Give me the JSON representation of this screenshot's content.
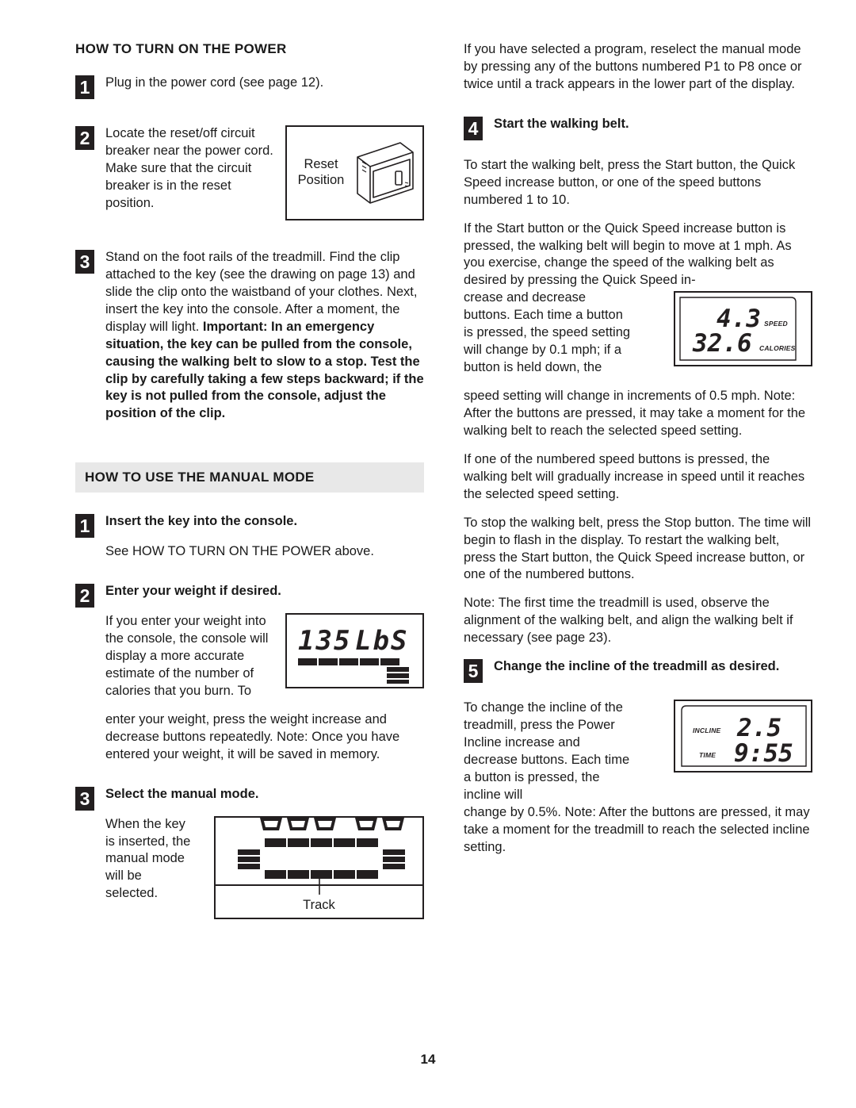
{
  "page": {
    "number": "14"
  },
  "left_column": {
    "section1": {
      "title": "HOW TO TURN ON THE POWER",
      "steps": [
        {
          "num": "1",
          "text": "Plug in the power cord (see page 12)."
        },
        {
          "num": "2",
          "text": "Locate the reset/off circuit breaker near the power cord. Make sure that the circuit breaker is in the reset position.",
          "figure": {
            "name": "reset-position-diagram",
            "label_line1": "Reset",
            "label_line2": "Position"
          }
        },
        {
          "num": "3",
          "text_normal": "Stand on the foot rails of the treadmill. Find the clip attached to the key (see the drawing on page 13) and slide the clip onto the waistband of your clothes. Next, insert the key into the console. After a moment, the display will light. ",
          "text_bold": "Important: In an emergency situation, the key can be pulled from the console, causing the walking belt to slow to a stop. Test the clip by carefully taking a few steps backward; if the key is not pulled from the console, adjust the position of the clip."
        }
      ]
    },
    "section2": {
      "title": "HOW TO USE THE MANUAL MODE",
      "steps": [
        {
          "num": "1",
          "heading": "Insert the key into the console.",
          "body": "See HOW TO TURN ON THE POWER above."
        },
        {
          "num": "2",
          "heading": "Enter your weight if desired.",
          "body_wrap": "If you enter your weight into the console, the console will display a more accurate estimate of the number of calories that you burn. To",
          "body_rest": "enter your weight, press the weight increase and decrease buttons repeatedly. Note: Once you have entered your weight, it will be saved in memory.",
          "figure": {
            "name": "weight-display",
            "value": "135",
            "unit": "LbS"
          }
        },
        {
          "num": "3",
          "heading": "Select the manual mode.",
          "body": "When the key is inserted, the manual mode will be selected.",
          "figure": {
            "name": "track-display",
            "caption": "Track"
          }
        }
      ]
    }
  },
  "right_column": {
    "intro_paragraph": "If you have selected a program, reselect the manual mode by pressing any of the buttons numbered P1 to P8 once or twice until a track appears in the lower part of the display.",
    "steps": [
      {
        "num": "4",
        "heading": "Start the walking belt.",
        "paragraphs": [
          "To start the walking belt, press the Start button, the Quick Speed increase button, or one of the speed buttons numbered 1 to 10.",
          "If the Start button or the Quick Speed increase button is pressed, the walking belt will begin to move at 1 mph. As you exercise, change the speed of the walking belt as desired by pressing the Quick Speed in-",
          "crease and decrease buttons. Each time a button is pressed, the speed setting will change by 0.1 mph; if a button is held down, the",
          "speed setting will change in increments of 0.5 mph. Note: After the buttons are pressed, it may take a moment for the walking belt to reach the selected speed setting.",
          "If one of the numbered speed buttons is pressed, the walking belt will gradually increase in speed until it reaches the selected speed setting.",
          "To stop the walking belt, press the Stop button. The time will begin to flash in the display. To restart the walking belt, press the Start button, the Quick Speed increase button, or one of the numbered buttons.",
          "Note: The first time the treadmill is used, observe the alignment of the walking belt, and align the walking belt if necessary (see page 23)."
        ],
        "figure": {
          "name": "speed-calories-display",
          "speed_value": "4.3",
          "speed_label": "SPEED",
          "calories_value": "32.6",
          "calories_label": "CALORIES"
        }
      },
      {
        "num": "5",
        "heading": "Change the incline of the treadmill as desired.",
        "body_wrap": "To change the incline of the treadmill, press the Power Incline increase and decrease buttons. Each time a button is pressed, the incline will",
        "body_rest": "change by 0.5%. Note: After the buttons are pressed, it may take a moment for the treadmill to reach the selected incline setting.",
        "figure": {
          "name": "incline-time-display",
          "incline_label": "INCLINE",
          "incline_value": "2.5",
          "time_label": "TIME",
          "time_value": "9:55"
        }
      }
    ]
  },
  "colors": {
    "ink": "#231f20",
    "section_bar_bg": "#e8e8e8"
  }
}
